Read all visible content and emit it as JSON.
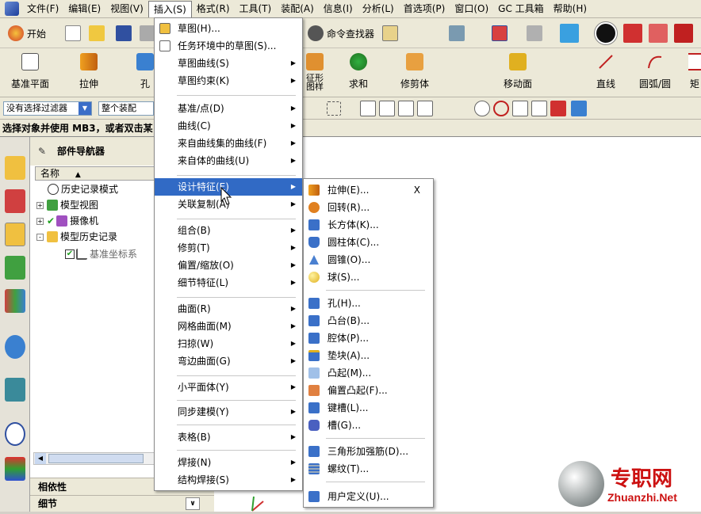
{
  "menubar": {
    "items": [
      "文件(F)",
      "编辑(E)",
      "视图(V)",
      "插入(S)",
      "格式(R)",
      "工具(T)",
      "装配(A)",
      "信息(I)",
      "分析(L)",
      "首选项(P)",
      "窗口(O)",
      "GC 工具箱",
      "帮助(H)"
    ],
    "active_index": 3
  },
  "toolbar1": {
    "start_label": "开始",
    "command_finder_label": "命令查找器"
  },
  "toolbar2": {
    "labels": [
      "基准平面",
      "拉伸",
      "孔",
      "征形\n图样",
      "求和",
      "修剪体",
      "移动面",
      "直线",
      "圆弧/圆",
      "矩"
    ]
  },
  "toolbar3": {
    "filter_value": "没有选择过滤器",
    "scope_value": "整个装配"
  },
  "status": {
    "prompt": "选择对象并使用 MB3，或者双击某"
  },
  "navigator": {
    "title": "部件导航器",
    "column_header": "名称",
    "tree": [
      {
        "label": "历史记录模式",
        "expander": ""
      },
      {
        "label": "模型视图",
        "expander": "+"
      },
      {
        "label": "摄像机",
        "expander": "+"
      },
      {
        "label": "模型历史记录",
        "expander": "-"
      },
      {
        "label": "基准坐标系",
        "expander": ""
      }
    ],
    "bottom_panels": [
      "相依性",
      "细节"
    ]
  },
  "insert_menu": {
    "items": [
      {
        "label": "草图(H)...",
        "submenu": false
      },
      {
        "label": "任务环境中的草图(S)...",
        "submenu": false
      },
      {
        "label": "草图曲线(S)",
        "submenu": true
      },
      {
        "label": "草图约束(K)",
        "submenu": true
      },
      {
        "label": "基准/点(D)",
        "submenu": true
      },
      {
        "label": "曲线(C)",
        "submenu": true
      },
      {
        "label": "来自曲线集的曲线(F)",
        "submenu": true
      },
      {
        "label": "来自体的曲线(U)",
        "submenu": true
      },
      {
        "label": "设计特征(E)",
        "submenu": true
      },
      {
        "label": "关联复制(A)",
        "submenu": true
      },
      {
        "label": "组合(B)",
        "submenu": true
      },
      {
        "label": "修剪(T)",
        "submenu": true
      },
      {
        "label": "偏置/缩放(O)",
        "submenu": true
      },
      {
        "label": "细节特征(L)",
        "submenu": true
      },
      {
        "label": "曲面(R)",
        "submenu": true
      },
      {
        "label": "网格曲面(M)",
        "submenu": true
      },
      {
        "label": "扫掠(W)",
        "submenu": true
      },
      {
        "label": "弯边曲面(G)",
        "submenu": true
      },
      {
        "label": "小平面体(Y)",
        "submenu": true
      },
      {
        "label": "同步建模(Y)",
        "submenu": true
      },
      {
        "label": "表格(B)",
        "submenu": true
      },
      {
        "label": "焊接(N)",
        "submenu": true
      },
      {
        "label": "结构焊接(S)",
        "submenu": true
      }
    ],
    "highlighted_index": 8
  },
  "design_feature_menu": {
    "close_label": "X",
    "items": [
      "拉伸(E)...",
      "回转(R)...",
      "长方体(K)...",
      "圆柱体(C)...",
      "圆锥(O)...",
      "球(S)...",
      "孔(H)...",
      "凸台(B)...",
      "腔体(P)...",
      "垫块(A)...",
      "凸起(M)...",
      "偏置凸起(F)...",
      "键槽(L)...",
      "槽(G)...",
      "三角形加强筋(D)...",
      "螺纹(T)...",
      "用户定义(U)..."
    ]
  },
  "watermark": {
    "text_cn": "专职网",
    "text_en": "Zhuanzhi.Net"
  },
  "colors": {
    "menu_highlight": "#316ac5",
    "chrome": "#ece9d8",
    "watermark_red": "#cc1111"
  }
}
